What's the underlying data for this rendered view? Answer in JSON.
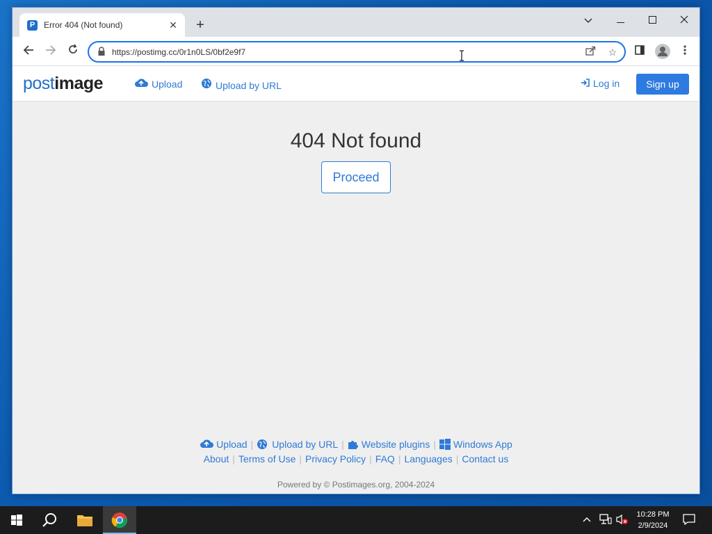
{
  "browser": {
    "tab_title": "Error 404 (Not found)",
    "tab_favicon_letter": "P",
    "url": "https://postimg.cc/0r1n0LS/0bf2e9f7"
  },
  "site": {
    "logo_part1": "post",
    "logo_part2": "image",
    "nav": {
      "upload": "Upload",
      "upload_url": "Upload by URL",
      "login": "Log in",
      "signup": "Sign up"
    },
    "heading": "404 Not found",
    "proceed": "Proceed",
    "footer_row1": {
      "upload": "Upload",
      "upload_url": "Upload by URL",
      "plugins": "Website plugins",
      "windows_app": "Windows App"
    },
    "footer_row2": {
      "about": "About",
      "terms": "Terms of Use",
      "privacy": "Privacy Policy",
      "faq": "FAQ",
      "languages": "Languages",
      "contact": "Contact us"
    },
    "powered": "Powered by © Postimages.org, 2004-2024"
  },
  "taskbar": {
    "time": "10:28 PM",
    "date": "2/9/2024"
  },
  "colors": {
    "accent": "#2f7ad6",
    "button_bg": "#2d7be0",
    "page_bg": "#efefef"
  }
}
